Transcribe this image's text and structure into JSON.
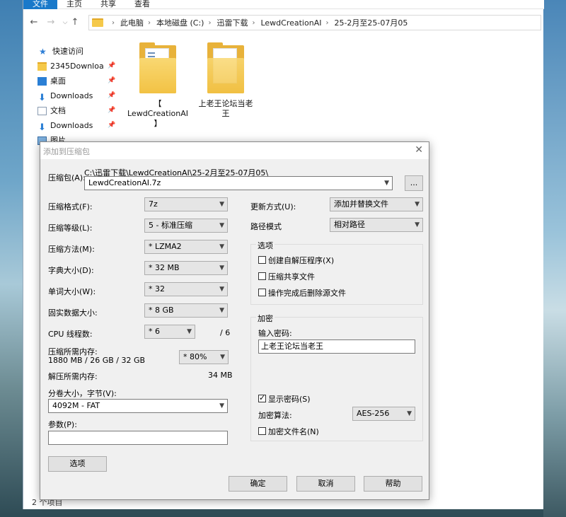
{
  "explorer": {
    "ribbon_tabs": [
      "文件",
      "主页",
      "共享",
      "查看"
    ],
    "breadcrumb": [
      "此电脑",
      "本地磁盘 (C:)",
      "迅雷下载",
      "LewdCreationAI",
      "25-2月至25-07月05"
    ],
    "nav_items": [
      {
        "label": "快速访问",
        "icon": "star-icon"
      },
      {
        "label": "2345Downloa",
        "icon": "folder-icon",
        "pinned": true
      },
      {
        "label": "桌面",
        "icon": "desktop-icon",
        "pinned": true
      },
      {
        "label": "Downloads",
        "icon": "download-icon",
        "pinned": true
      },
      {
        "label": "文档",
        "icon": "document-icon",
        "pinned": true
      },
      {
        "label": "Downloads",
        "icon": "download-icon",
        "pinned": true
      },
      {
        "label": "图片",
        "icon": "picture-icon",
        "pinned": true
      }
    ],
    "files": [
      {
        "label_line1": "【",
        "label_line2": "LewdCreationAI",
        "label_line3": "】"
      },
      {
        "label_line1": "上老王论坛当老",
        "label_line2": "王",
        "label_line3": ""
      }
    ],
    "status": "2 个项目"
  },
  "dialog": {
    "title": "添加到压缩包",
    "archive_label": "压缩包(A):",
    "archive_path": "C:\\迅雷下载\\LewdCreationAI\\25-2月至25-07月05\\",
    "archive_name": "LewdCreationAI.7z",
    "browse_label": "...",
    "format_label": "压缩格式(F):",
    "format_value": "7z",
    "level_label": "压缩等级(L):",
    "level_value": "5 - 标准压缩",
    "method_label": "压缩方法(M):",
    "method_value": "* LZMA2",
    "dict_label": "字典大小(D):",
    "dict_value": "* 32 MB",
    "word_label": "单词大小(W):",
    "word_value": "* 32",
    "solid_label": "固实数据大小:",
    "solid_value": "* 8 GB",
    "cpu_label": "CPU 线程数:",
    "cpu_value": "* 6",
    "cpu_total": "/ 6",
    "mem_comp_label": "压缩所需内存:",
    "mem_comp_value": "1880 MB / 26 GB / 32 GB",
    "mem_pct_value": "* 80%",
    "mem_decomp_label": "解压所需内存:",
    "mem_decomp_value": "34 MB",
    "volume_label": "分卷大小，字节(V):",
    "volume_value": "4092M - FAT",
    "params_label": "参数(P):",
    "params_value": "",
    "options_button": "选项",
    "update_label": "更新方式(U):",
    "update_value": "添加并替换文件",
    "pathmode_label": "路径模式",
    "pathmode_value": "相对路径",
    "options_group": "选项",
    "opt_sfx": "创建自解压程序(X)",
    "opt_shared": "压缩共享文件",
    "opt_delete": "操作完成后删除源文件",
    "encrypt_group": "加密",
    "password_label": "输入密码:",
    "password_value": "上老王论坛当老王",
    "show_password": "显示密码(S)",
    "enc_method_label": "加密算法:",
    "enc_method_value": "AES-256",
    "encrypt_names": "加密文件名(N)",
    "ok_button": "确定",
    "cancel_button": "取消",
    "help_button": "帮助"
  }
}
